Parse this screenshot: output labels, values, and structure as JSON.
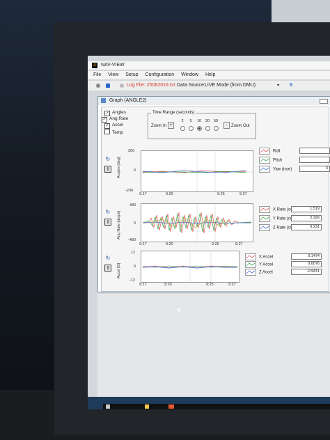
{
  "window": {
    "app_title": "NAV-VIEW",
    "logo": "A"
  },
  "menu": [
    "File",
    "View",
    "Setup",
    "Configuration",
    "Window",
    "Help"
  ],
  "toolbar": {
    "log_file_label": "Log File: 25082019.txt",
    "data_source_label": "Data Source:",
    "data_source_value": "LIVE Mode (from DMU)",
    "pause_icon": "II"
  },
  "graph_window": {
    "title": "Graph (ANGLE2)",
    "checkboxes": [
      {
        "label": "Angles",
        "checked": true
      },
      {
        "label": "Ang Rate",
        "checked": true
      },
      {
        "label": "Accel",
        "checked": true
      },
      {
        "label": "Temp",
        "checked": false
      }
    ],
    "time_range": {
      "label": "Time Range (seconds)",
      "zoom_in": "Zoom In",
      "zoom_out": "Zoom Out",
      "plus": "+",
      "minus": "-",
      "options": [
        "2",
        "5",
        "10",
        "20",
        "50"
      ],
      "selected": "10"
    },
    "panels": [
      {
        "ylabel": "Angles [deg]",
        "yticks": [
          "200",
          "0",
          "-200"
        ],
        "xticks": [
          "9:17",
          "9:20",
          "9:25",
          "9:27"
        ],
        "legend": [
          {
            "name": "Roll",
            "value": ""
          },
          {
            "name": "Pitch",
            "value": ""
          },
          {
            "name": "Yaw (true)",
            "value": "3"
          }
        ]
      },
      {
        "ylabel": "Ang Rate [deg/s]",
        "yticks": [
          "480",
          "0",
          "-480"
        ],
        "xticks": [
          "9:17",
          "9:20",
          "9:25",
          "9:27"
        ],
        "legend": [
          {
            "name": "X Rate (corr)",
            "value": "1.519"
          },
          {
            "name": "Y Rate (corr)",
            "value": "2.326"
          },
          {
            "name": "Z Rate (corr)",
            "value": "0.231"
          }
        ]
      },
      {
        "ylabel": "Accel [G]",
        "yticks": [
          "12",
          "0",
          "-12"
        ],
        "xticks": [
          "9:17",
          "9:20",
          "9:25",
          "9:27"
        ],
        "legend": [
          {
            "name": "X Accel",
            "value": "0.1474"
          },
          {
            "name": "Y Accel",
            "value": "0.0076"
          },
          {
            "name": "Z Accel",
            "value": "-0.9811"
          }
        ]
      }
    ]
  },
  "colors": {
    "roll": "#e0565b",
    "pitch": "#3aa84a",
    "yaw": "#4a6fd0",
    "accent": "#d63a2a"
  }
}
